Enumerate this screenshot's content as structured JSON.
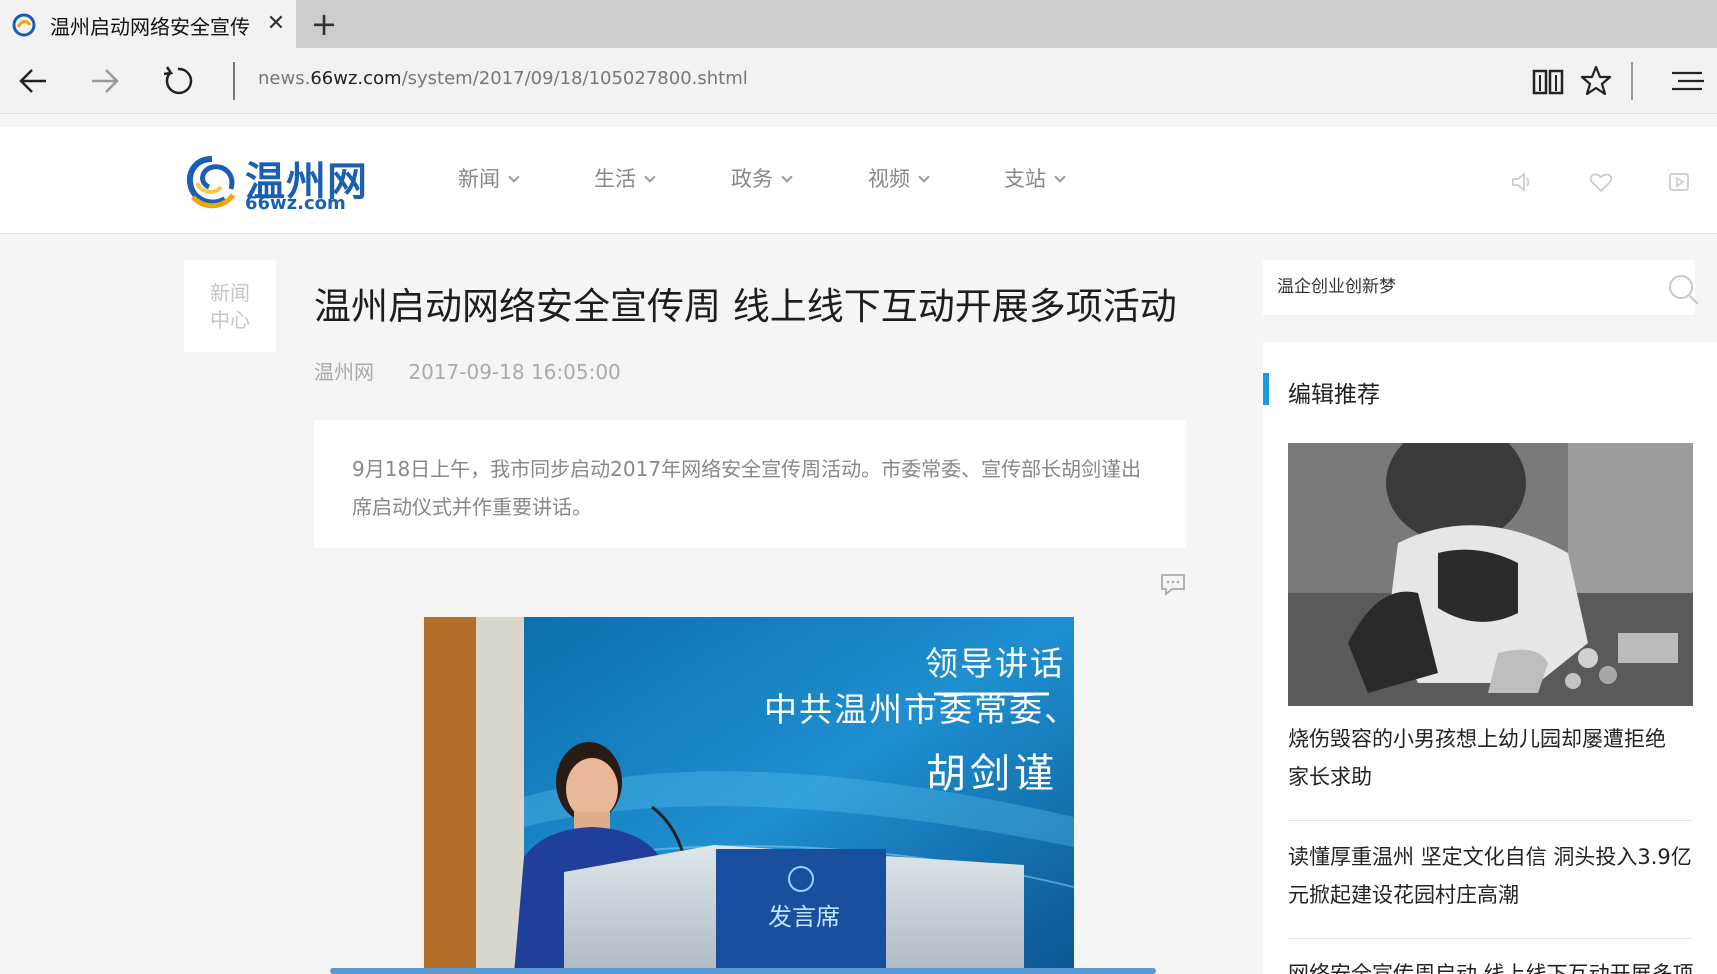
{
  "browser": {
    "tab_title": "温州启动网络安全宣传周 线上线下互动开展多项活动",
    "close_symbol": "✕",
    "new_tab_symbol": "+",
    "url_prefix": "news.",
    "url_host": "66wz.com",
    "url_path": "/system/2017/09/18/105027800.shtml"
  },
  "site": {
    "logo_cn": "温州网",
    "logo_en": "66wz.com",
    "nav": [
      {
        "label": "新闻"
      },
      {
        "label": "生活"
      },
      {
        "label": "政务"
      },
      {
        "label": "视频"
      },
      {
        "label": "支站"
      }
    ]
  },
  "article": {
    "section_label_line1": "新闻",
    "section_label_line2": "中心",
    "title": "温州启动网络安全宣传周 线上线下互动开展多项活动",
    "source": "温州网",
    "datetime": "2017-09-18 16:05:00",
    "summary": "9月18日上午，我市同步启动2017年网络安全宣传周活动。市委常委、宣传部长胡剑谨出席启动仪式并作重要讲话。",
    "photo": {
      "screen_line1": "领导讲话",
      "screen_line2": "中共温州市委常委、",
      "screen_line3": "胡剑谨",
      "podium_text": "发言席"
    }
  },
  "sidebar": {
    "search_placeholder": "温企创业创新梦",
    "recommend_title": "编辑推荐",
    "items": [
      {
        "text": "烧伤毁容的小男孩想上幼儿园却屡遭拒绝 家长求助"
      },
      {
        "text": "读懂厚重温州 坚定文化自信 洞头投入3.9亿元掀起建设花园村庄高潮"
      },
      {
        "text": "网络安全宣传周启动 线上线下互动开展多项"
      }
    ]
  },
  "colors": {
    "accent": "#1a9bea",
    "logo_blue": "#1b5fb4"
  }
}
